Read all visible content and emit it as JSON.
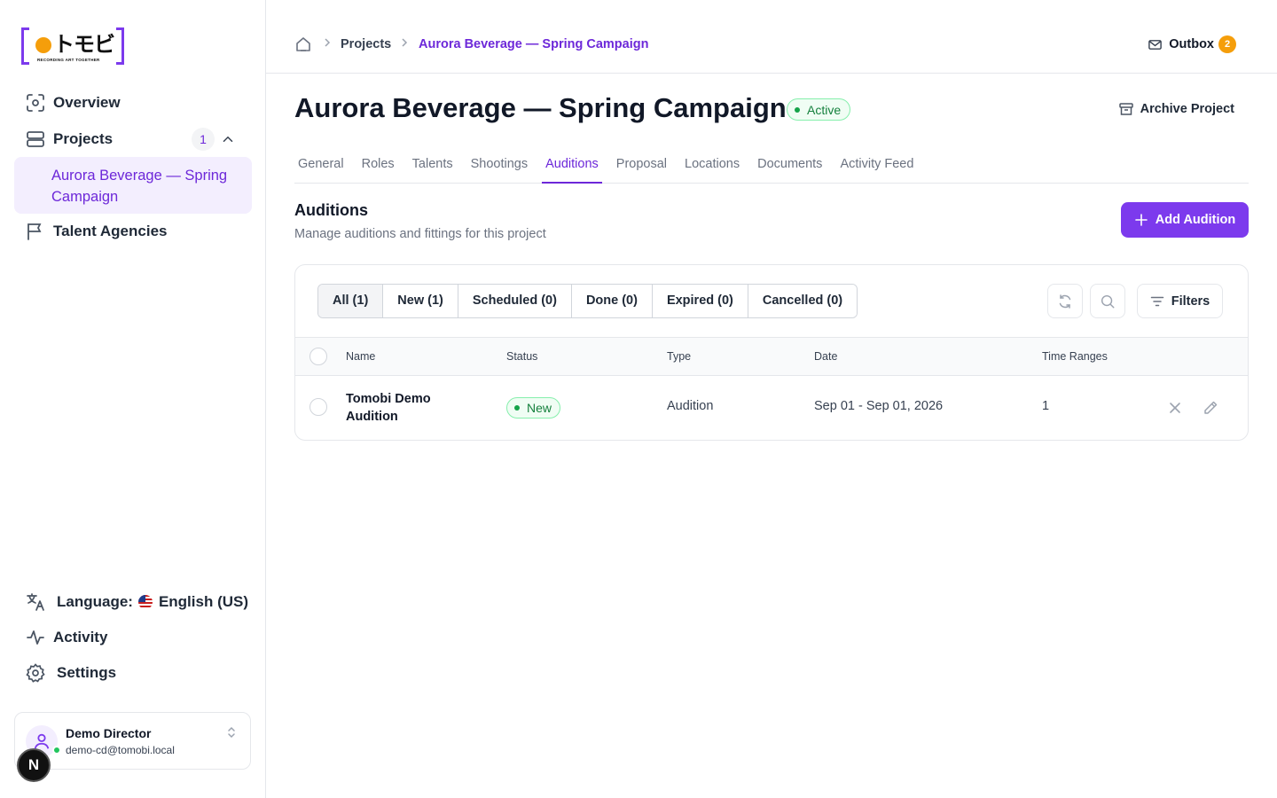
{
  "logo": {
    "jp": "トモビ",
    "tagline": "RECORDING ART TOGETHER"
  },
  "sidebar": {
    "items": [
      {
        "label": "Overview",
        "icon": "scan-icon"
      },
      {
        "label": "Projects",
        "icon": "layers-icon",
        "count": "1",
        "sub": "Aurora Beverage — Spring Campaign"
      },
      {
        "label": "Talent Agencies",
        "icon": "flag-icon"
      }
    ],
    "bottom": {
      "language_label": "Language:",
      "language_value": "English (US)",
      "activity": "Activity",
      "settings": "Settings"
    },
    "user": {
      "name": "Demo Director",
      "email": "demo-cd@tomobi.local",
      "badge": "N"
    }
  },
  "breadcrumb": {
    "projects": "Projects",
    "current": "Aurora Beverage — Spring Campaign"
  },
  "outbox": {
    "label": "Outbox",
    "count": "2"
  },
  "project": {
    "title": "Aurora Beverage — Spring Campaign",
    "status": "Active",
    "archive_label": "Archive Project"
  },
  "tabs": [
    "General",
    "Roles",
    "Talents",
    "Shootings",
    "Auditions",
    "Proposal",
    "Locations",
    "Documents",
    "Activity Feed"
  ],
  "active_tab": "Auditions",
  "section": {
    "title": "Auditions",
    "subtitle": "Manage auditions and fittings for this project",
    "add_label": "Add Audition"
  },
  "filters": {
    "segments": [
      "All (1)",
      "New (1)",
      "Scheduled (0)",
      "Done (0)",
      "Expired (0)",
      "Cancelled (0)"
    ],
    "filters_label": "Filters"
  },
  "table": {
    "columns": [
      "Name",
      "Status",
      "Type",
      "Date",
      "Time Ranges"
    ],
    "rows": [
      {
        "name_line1": "Tomobi Demo",
        "name_line2": "Audition",
        "status": "New",
        "type": "Audition",
        "date": "Sep 01 - Sep 01, 2026",
        "time_ranges": "1"
      }
    ]
  },
  "colors": {
    "accent": "#7c3aed",
    "accent_bg": "#f3eefe",
    "status_green": "#15803d",
    "outbox_badge": "#f59e0b"
  }
}
